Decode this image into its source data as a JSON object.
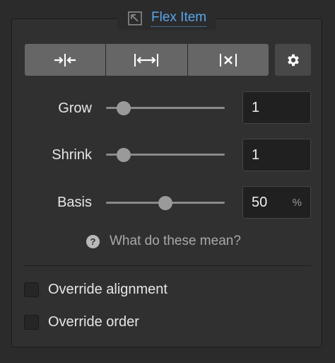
{
  "panel": {
    "title": "Flex Item",
    "title_icon": "expand-arrow-icon",
    "accent": "#5aa5ef"
  },
  "sizing_buttons": [
    {
      "name": "shrink-button",
      "icon": "arrows-inward-icon"
    },
    {
      "name": "grow-button",
      "icon": "arrows-outward-icon"
    },
    {
      "name": "none-button",
      "icon": "x-between-bars-icon"
    }
  ],
  "settings_icon": "gear-icon",
  "rows": {
    "grow": {
      "label": "Grow",
      "value": "1",
      "slider_fraction": 0.15
    },
    "shrink": {
      "label": "Shrink",
      "value": "1",
      "slider_fraction": 0.15
    },
    "basis": {
      "label": "Basis",
      "value": "50",
      "unit": "%",
      "slider_fraction": 0.5
    }
  },
  "help_text": "What do these mean?",
  "checkboxes": {
    "override_alignment": {
      "label": "Override alignment",
      "checked": false
    },
    "override_order": {
      "label": "Override order",
      "checked": false
    }
  }
}
